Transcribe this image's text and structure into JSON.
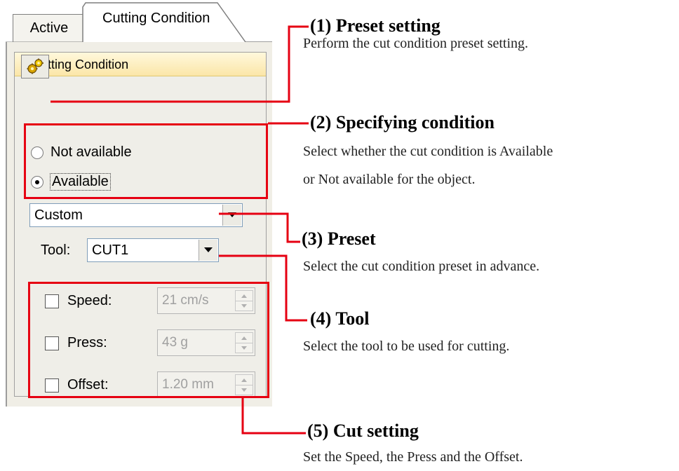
{
  "tabs": {
    "active_label": "Active",
    "cutting_label": "Cutting Condition"
  },
  "panel": {
    "header_title": "Cutting Condition",
    "preset_button_icon": "gears-icon",
    "radio_not_available": "Not available",
    "radio_available": "Available",
    "preset_value": "Custom",
    "tool_label": "Tool:",
    "tool_value": "CUT1",
    "settings": [
      {
        "label": "Speed:",
        "value": "21 cm/s"
      },
      {
        "label": "Press:",
        "value": "43 g"
      },
      {
        "label": "Offset:",
        "value": "1.20 mm"
      }
    ]
  },
  "annotations": [
    {
      "title": "(1) Preset setting",
      "lines": [
        "Perform the cut condition preset setting."
      ]
    },
    {
      "title": "(2) Specifying condition",
      "lines": [
        "Select whether the cut condition is Available",
        "or Not available for the object."
      ]
    },
    {
      "title": "(3) Preset",
      "lines": [
        "Select the cut condition preset in advance."
      ]
    },
    {
      "title": "(4) Tool",
      "lines": [
        "Select the tool to be used for cutting."
      ]
    },
    {
      "title": "(5) Cut setting",
      "lines": [
        "Set the Speed, the Press and the Offset."
      ]
    }
  ],
  "colors": {
    "annotation_red": "#e60012",
    "header_bg": "#fbe6a8",
    "panel_bg": "#f0eee6"
  }
}
